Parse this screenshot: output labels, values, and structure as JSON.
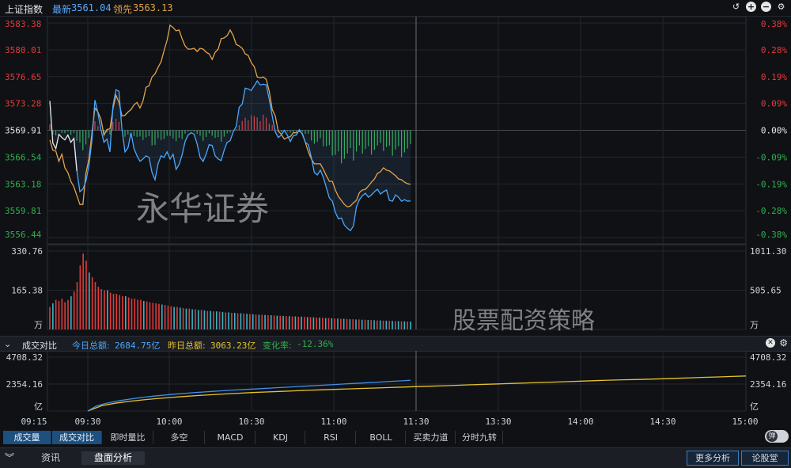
{
  "header": {
    "index_name": "上证指数",
    "latest_label": "最新",
    "latest_value": "3561.04",
    "lead_label": "领先",
    "lead_value": "3563.13"
  },
  "window_icons": [
    "undo-icon",
    "zoom-in-icon",
    "zoom-out-icon",
    "settings-icon"
  ],
  "price_axis": {
    "left_ticks": [
      "3583.38",
      "3580.01",
      "3576.65",
      "3573.28",
      "3569.91",
      "3566.54",
      "3563.18",
      "3559.81",
      "3556.44"
    ],
    "right_ticks": [
      "0.38%",
      "0.28%",
      "0.19%",
      "0.09%",
      "0.00%",
      "-0.09%",
      "-0.19%",
      "-0.28%",
      "-0.38%"
    ]
  },
  "volume_axis": {
    "left_ticks": [
      "330.76",
      "165.38",
      "万"
    ],
    "right_ticks": [
      "1011.30",
      "505.65",
      "万"
    ]
  },
  "watermarks": {
    "main": "永华证券",
    "secondary": "股票配资策略"
  },
  "compare_panel": {
    "title": "成交对比",
    "today_label": "今日总额:",
    "today_value": "2684.75亿",
    "yesterday_label": "昨日总额:",
    "yesterday_value": "3063.23亿",
    "change_label": "变化率:",
    "change_value": "-12.36%",
    "left_ticks": [
      "4708.32",
      "2354.16",
      "亿"
    ],
    "right_ticks": [
      "4708.32",
      "2354.16",
      "亿"
    ]
  },
  "time_axis": [
    "09:15",
    "09:30",
    "10:00",
    "10:30",
    "11:00",
    "11:30",
    "13:30",
    "14:00",
    "14:30",
    "15:00"
  ],
  "indicator_tabs": [
    "成交量",
    "成交对比",
    "即时量比",
    "多空",
    "MACD",
    "KDJ",
    "RSI",
    "BOLL",
    "买卖力道",
    "分时九转"
  ],
  "active_indicator_tab": 1,
  "toggle_label": "弹",
  "bottom_tabs": [
    "资讯",
    "盘面分析"
  ],
  "bottom_active_tab": 1,
  "bottom_buttons": [
    "更多分析",
    "论股堂"
  ],
  "colors": {
    "up": "#e23b3b",
    "down": "#2fb14f",
    "price_line": "#4aa8ff",
    "avg_line": "#e3a34b",
    "today_line": "#3f8fe8",
    "yesterday_line": "#e6c32e"
  },
  "chart_data": {
    "type": "line",
    "x_range": [
      "09:15",
      "15:00"
    ],
    "ylim": [
      3556.44,
      3583.38
    ],
    "prev_close": 3569.91,
    "series": [
      {
        "name": "最新",
        "values": [
          3573.6,
          3568.3,
          3567.6,
          3569.4,
          3569.0,
          3568.7,
          3569.3,
          3568.4,
          3568.9,
          3564.8,
          3562.2,
          3562.5,
          3563.5,
          3565.5,
          3568.6,
          3573.7,
          3572.1,
          3570.0,
          3568.4,
          3568.8,
          3567.2,
          3573.0,
          3575.0,
          3574.8,
          3570.0,
          3567.2,
          3567.7,
          3569.6,
          3567.6,
          3566.7,
          3566.0,
          3566.3,
          3566.7,
          3566.5,
          3564.6,
          3563.7,
          3565.7,
          3566.7,
          3566.5,
          3567.2,
          3566.3,
          3566.9,
          3565.0,
          3565.6,
          3566.8,
          3568.5,
          3569.3,
          3569.6,
          3569.4,
          3568.2,
          3566.5,
          3566.0,
          3566.9,
          3568.1,
          3568.0,
          3566.7,
          3566.3,
          3566.1,
          3567.4,
          3568.4,
          3568.6,
          3569.7,
          3570.4,
          3572.8,
          3573.2,
          3575.2,
          3575.1,
          3574.9,
          3575.5,
          3576.1,
          3575.6,
          3575.7,
          3575.6,
          3573.8,
          3571.7,
          3569.7,
          3569.0,
          3569.3,
          3569.9,
          3569.3,
          3568.5,
          3569.2,
          3569.3,
          3570.0,
          3569.4,
          3568.4,
          3568.1,
          3566.5,
          3564.6,
          3564.3,
          3564.9,
          3564.0,
          3562.7,
          3561.4,
          3561.0,
          3559.6,
          3558.8,
          3558.9,
          3558.0,
          3557.6,
          3557.3,
          3557.9,
          3560.3,
          3561.2,
          3561.7,
          3562.0,
          3561.5,
          3561.8,
          3562.2,
          3562.5,
          3561.9,
          3562.2,
          3562.4,
          3561.1,
          3561.0,
          3561.8,
          3561.5,
          3561.0,
          3561.2,
          3561.0,
          3561.04
        ]
      },
      {
        "name": "领先",
        "values": [
          3568.7,
          3567.4,
          3567.3,
          3566.0,
          3566.9,
          3565.2,
          3564.6,
          3563.5,
          3562.8,
          3561.7,
          3560.6,
          3560.6,
          3564.5,
          3566.3,
          3569.5,
          3572.7,
          3572.2,
          3571.3,
          3569.3,
          3570.0,
          3570.1,
          3572.6,
          3574.3,
          3573.4,
          3571.7,
          3571.8,
          3572.2,
          3572.5,
          3573.1,
          3573.4,
          3572.7,
          3573.6,
          3575.3,
          3575.5,
          3576.6,
          3577.0,
          3577.8,
          3578.5,
          3579.9,
          3581.2,
          3583.1,
          3582.8,
          3582.4,
          3582.5,
          3581.4,
          3580.5,
          3580.1,
          3580.1,
          3580.2,
          3579.8,
          3580.2,
          3580.1,
          3579.7,
          3579.5,
          3578.8,
          3579.7,
          3580.1,
          3581.4,
          3581.5,
          3581.8,
          3582.5,
          3581.8,
          3580.7,
          3580.5,
          3580.2,
          3579.5,
          3579.3,
          3578.4,
          3577.9,
          3576.6,
          3576.5,
          3576.6,
          3576.3,
          3574.8,
          3572.5,
          3571.7,
          3569.8,
          3569.4,
          3568.8,
          3569.0,
          3569.1,
          3569.6,
          3569.6,
          3569.8,
          3569.5,
          3568.4,
          3567.2,
          3566.3,
          3565.7,
          3565.7,
          3565.7,
          3565.0,
          3564.2,
          3563.5,
          3563.5,
          3562.4,
          3561.6,
          3561.1,
          3560.6,
          3560.3,
          3560.4,
          3560.8,
          3561.1,
          3562.1,
          3562.4,
          3562.5,
          3562.9,
          3563.4,
          3563.8,
          3564.5,
          3564.7,
          3565.2,
          3564.9,
          3564.8,
          3564.5,
          3564.2,
          3563.8,
          3563.7,
          3563.4,
          3563.2,
          3563.13
        ]
      }
    ],
    "volume": {
      "unit": "万",
      "ylim": [
        0,
        330.76
      ],
      "values": [
        95,
        110,
        125,
        120,
        130,
        115,
        125,
        140,
        160,
        200,
        270,
        320,
        290,
        240,
        220,
        200,
        180,
        170,
        165,
        165,
        155,
        150,
        150,
        145,
        140,
        140,
        135,
        130,
        130,
        125,
        125,
        120,
        118,
        115,
        112,
        110,
        108,
        105,
        103,
        100,
        98,
        95,
        95,
        92,
        90,
        88,
        88,
        85,
        85,
        82,
        82,
        80,
        78,
        78,
        76,
        76,
        75,
        74,
        72,
        72,
        70,
        70,
        68,
        68,
        67,
        66,
        65,
        64,
        63,
        62,
        62,
        61,
        60,
        60,
        59,
        58,
        58,
        57,
        56,
        56,
        55,
        55,
        54,
        54,
        53,
        52,
        52,
        51,
        50,
        50,
        49,
        48,
        48,
        47,
        46,
        46,
        45,
        45,
        44,
        43,
        43,
        42,
        42,
        41,
        41,
        40,
        40,
        39,
        38,
        38,
        37,
        37,
        36,
        36,
        35,
        35,
        34,
        34,
        33,
        33
      ]
    },
    "turnover_compare": {
      "unit": "亿",
      "ylim": [
        0,
        4708.32
      ],
      "today": [
        0,
        420,
        630,
        790,
        920,
        1030,
        1130,
        1220,
        1300,
        1370,
        1440,
        1500,
        1560,
        1610,
        1660,
        1710,
        1760,
        1800,
        1840,
        1880,
        1920,
        1960,
        2000,
        2040,
        2080,
        2120,
        2160,
        2200,
        2240,
        2280,
        2320,
        2360,
        2400,
        2440,
        2480,
        2520,
        2560,
        2600,
        2640,
        2684.75
      ],
      "yesterday": [
        0,
        460,
        680,
        840,
        970,
        1080,
        1180,
        1270,
        1350,
        1420,
        1490,
        1550,
        1610,
        1660,
        1710,
        1760,
        1810,
        1850,
        1890,
        1930,
        1970,
        2010,
        2050,
        2090,
        2130,
        2170,
        2210,
        2250,
        2290,
        2330,
        2370,
        2410,
        2450,
        2490,
        2530,
        2570,
        2610,
        2650,
        2690,
        2730,
        2750,
        2780,
        2820,
        2860,
        2900,
        2940,
        2980,
        3020,
        3063.23
      ]
    }
  }
}
